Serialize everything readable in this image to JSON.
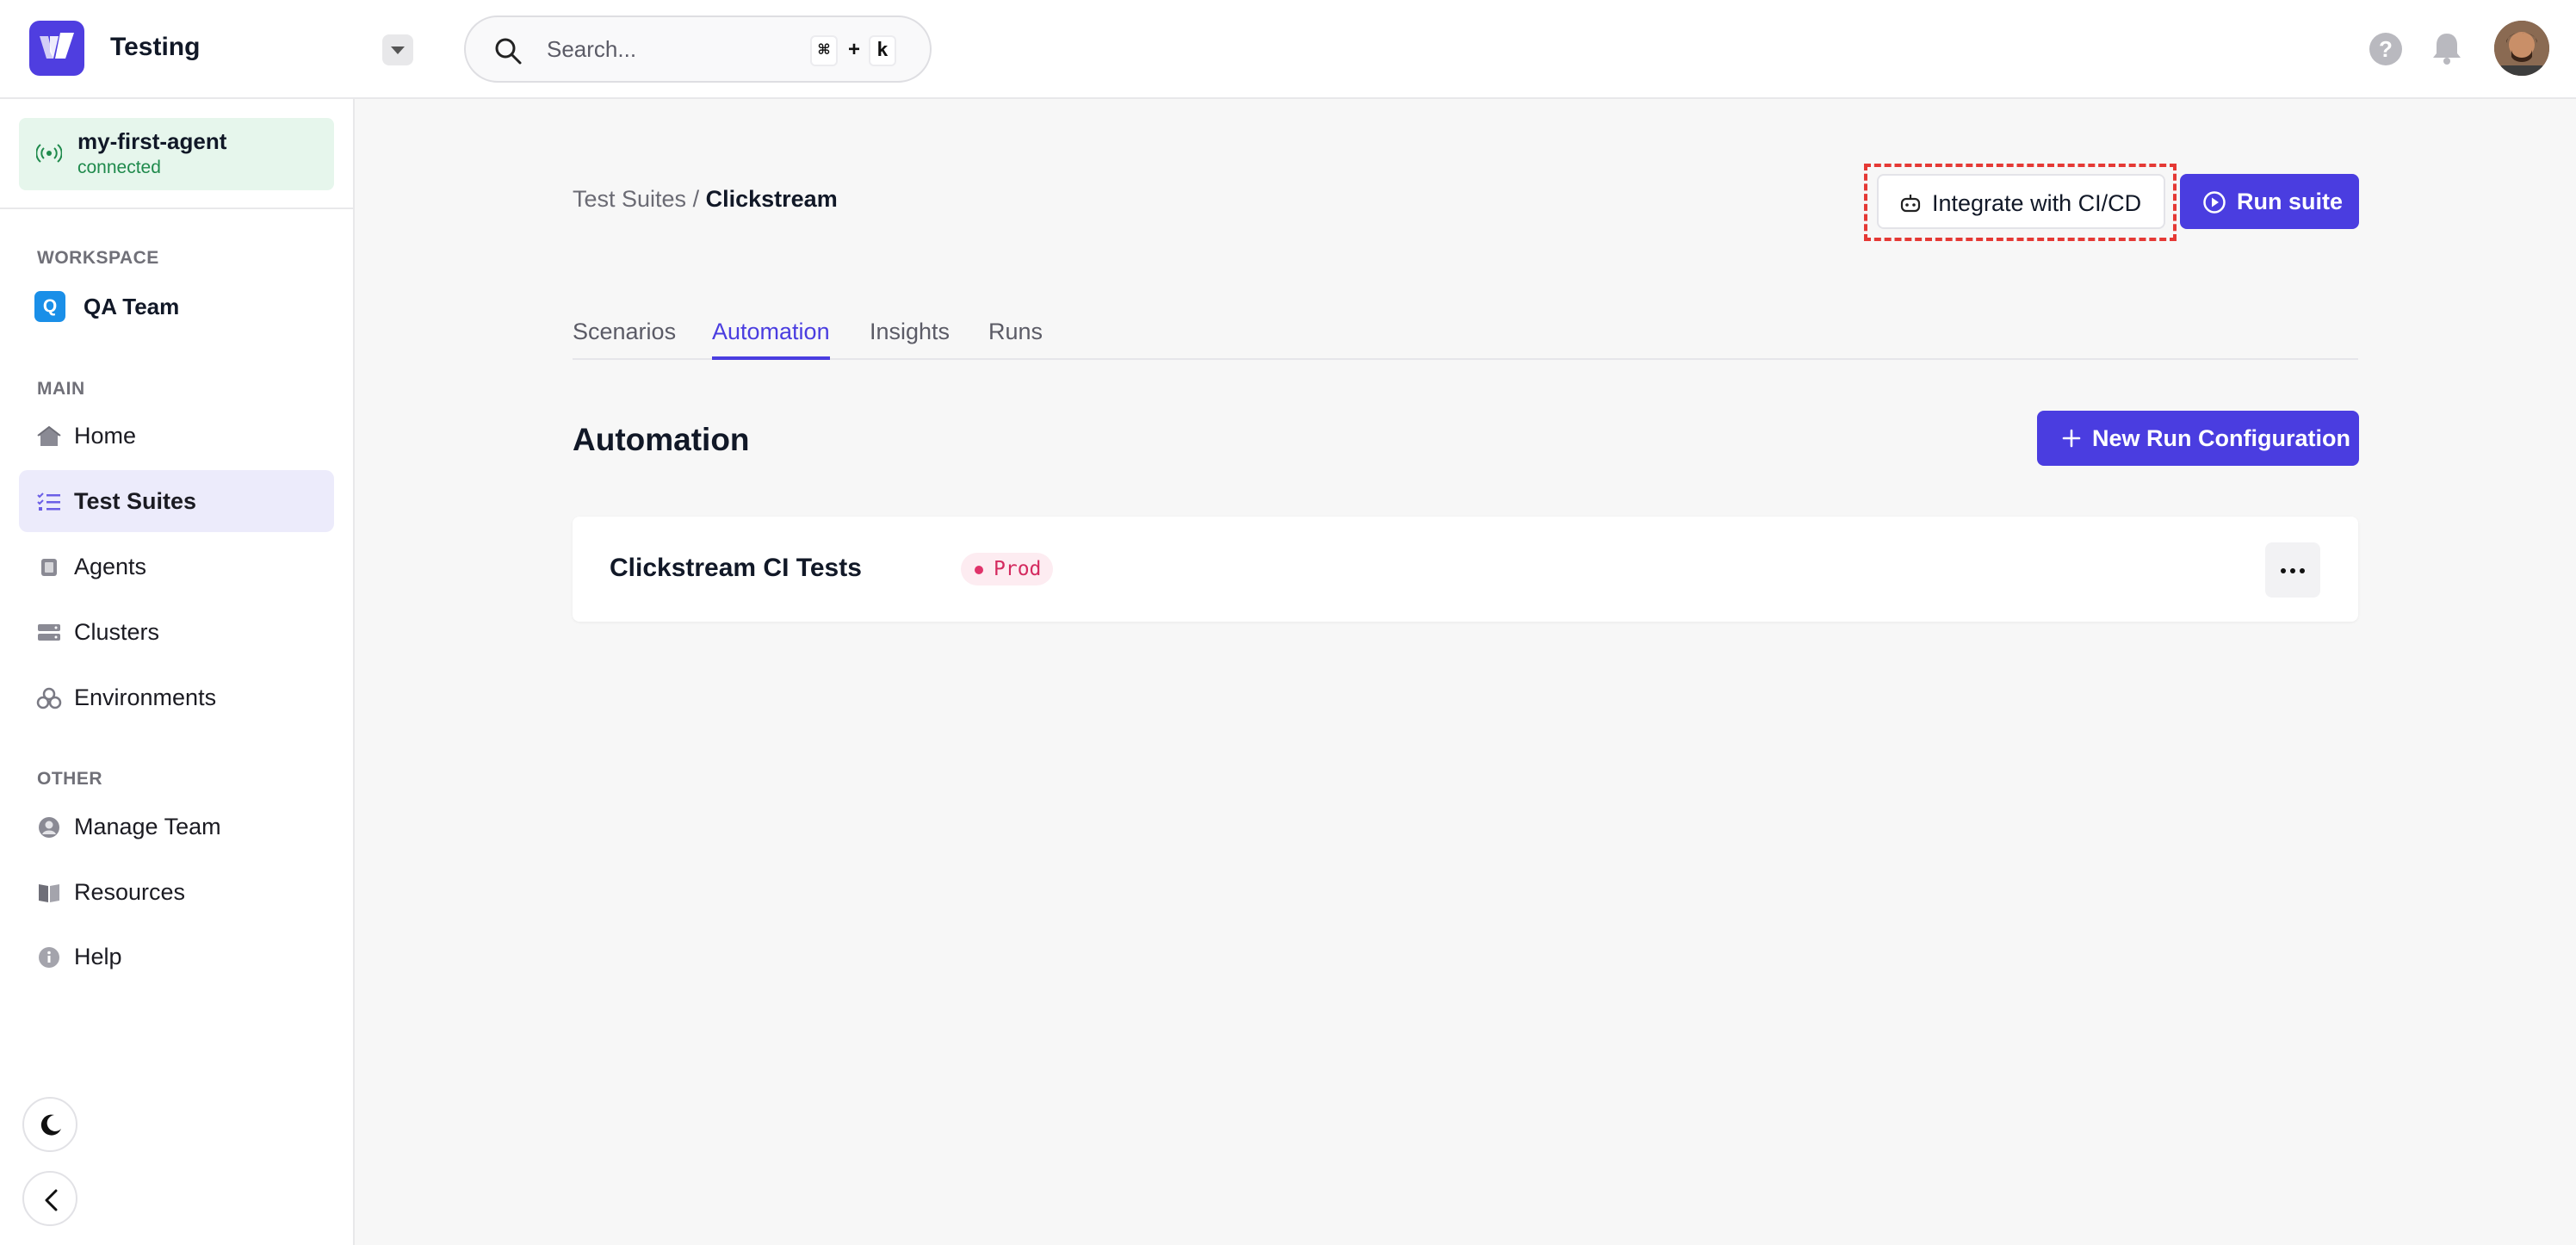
{
  "app": {
    "name": "Testing"
  },
  "search": {
    "placeholder": "Search...",
    "shortcut_key1": "⌘",
    "shortcut_plus": "+",
    "shortcut_key2": "k"
  },
  "agent": {
    "name": "my-first-agent",
    "status": "connected"
  },
  "sidebar": {
    "workspace_label": "WORKSPACE",
    "workspace": {
      "initial": "Q",
      "name": "QA Team"
    },
    "main_label": "MAIN",
    "main_items": [
      {
        "label": "Home",
        "icon": "home-icon"
      },
      {
        "label": "Test Suites",
        "icon": "list-check-icon",
        "active": true
      },
      {
        "label": "Agents",
        "icon": "chip-icon"
      },
      {
        "label": "Clusters",
        "icon": "server-icon"
      },
      {
        "label": "Environments",
        "icon": "cubes-icon"
      }
    ],
    "other_label": "OTHER",
    "other_items": [
      {
        "label": "Manage Team",
        "icon": "user-circle-icon"
      },
      {
        "label": "Resources",
        "icon": "book-icon"
      },
      {
        "label": "Help",
        "icon": "info-icon"
      }
    ]
  },
  "breadcrumb": {
    "parent": "Test Suites",
    "separator": "/",
    "current": "Clickstream"
  },
  "actions": {
    "integrate_label": "Integrate with CI/CD",
    "run_label": "Run suite"
  },
  "tabs": [
    {
      "label": "Scenarios"
    },
    {
      "label": "Automation",
      "active": true
    },
    {
      "label": "Insights"
    },
    {
      "label": "Runs"
    }
  ],
  "automation": {
    "title": "Automation",
    "new_button_label": "New Run Configuration",
    "configs": [
      {
        "name": "Clickstream CI Tests",
        "environment": "Prod"
      }
    ]
  },
  "colors": {
    "accent": "#4a3de0",
    "connected_bg": "#e6f6ec",
    "connected_text": "#1f8a4c",
    "prod_badge": "#d42a5f",
    "highlight": "#e53935"
  }
}
